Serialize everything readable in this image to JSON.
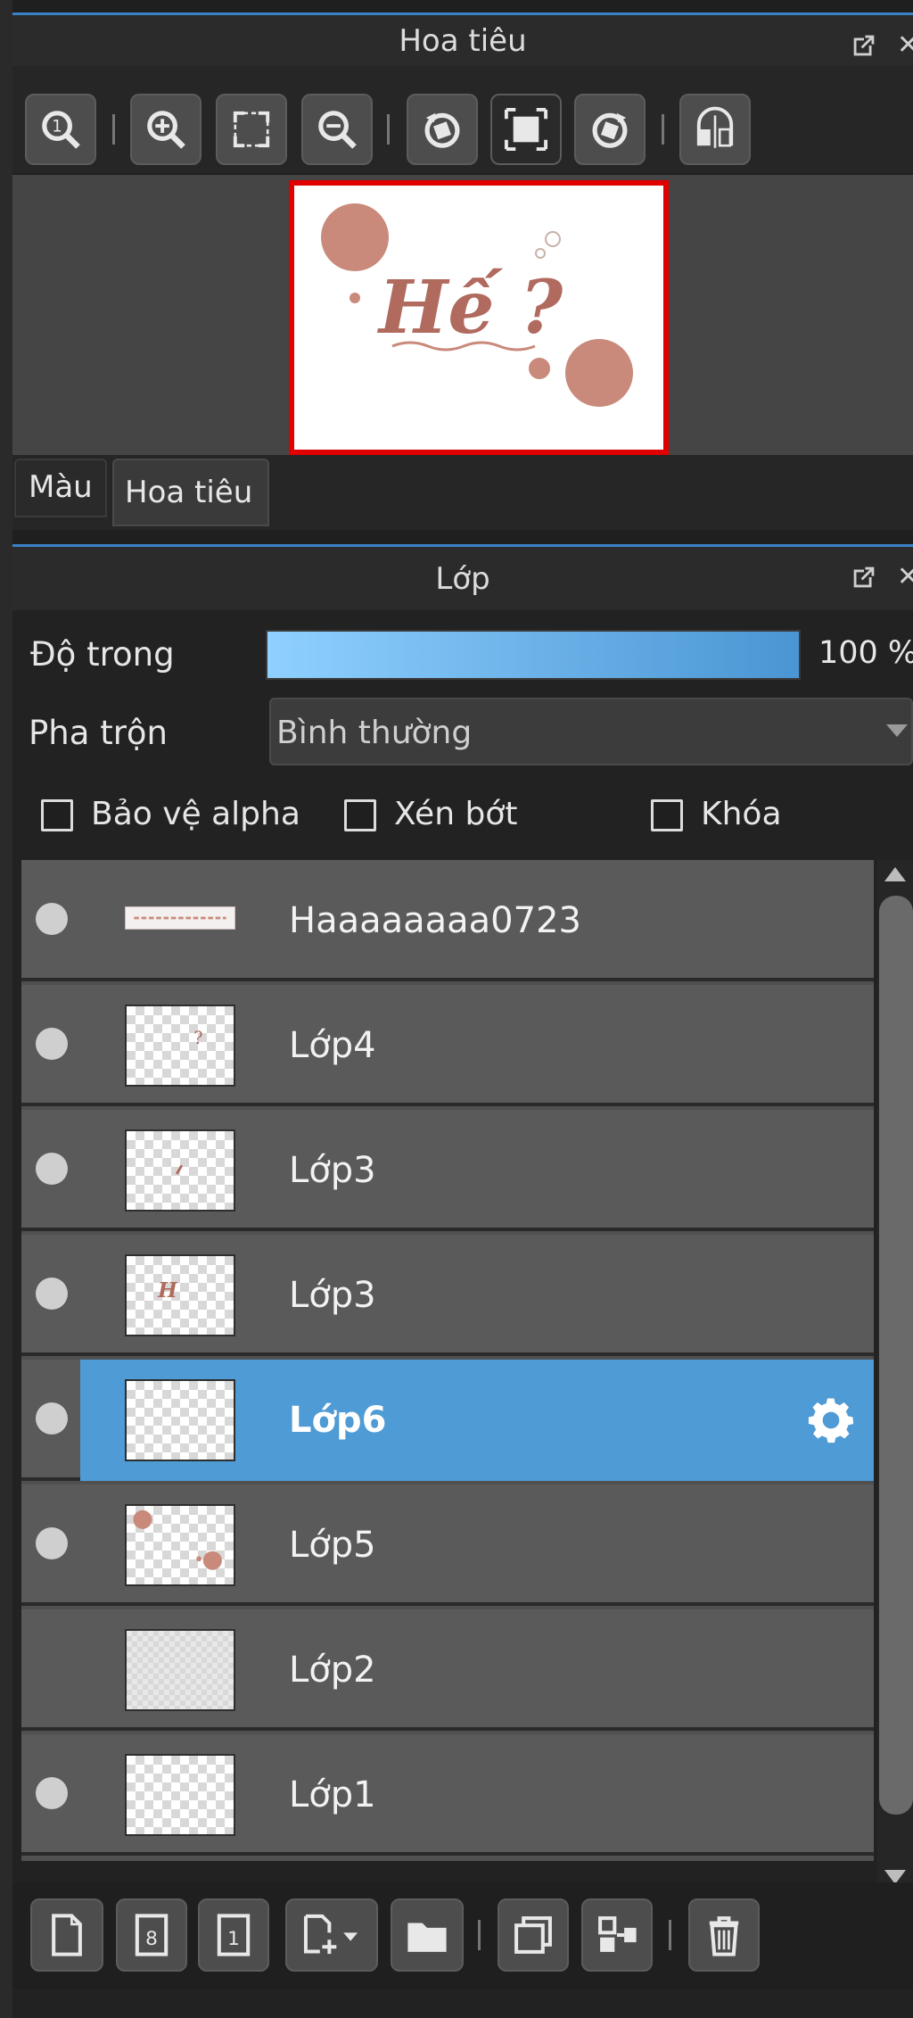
{
  "navigator": {
    "title": "Hoa tiêu",
    "tools": [
      {
        "name": "zoom-actual-icon"
      },
      {
        "name": "zoom-in-icon"
      },
      {
        "name": "fit-window-icon"
      },
      {
        "name": "zoom-out-icon"
      },
      {
        "name": "rotate-left-icon"
      },
      {
        "name": "fit-canvas-icon"
      },
      {
        "name": "rotate-right-icon"
      },
      {
        "name": "flip-horizontal-icon"
      }
    ],
    "preview": {
      "text": "Hế ?",
      "frame_color": "#e00000",
      "accent_color": "#c98a7c"
    },
    "tabs": [
      {
        "label": "Màu",
        "active": false
      },
      {
        "label": "Hoa tiêu",
        "active": true
      }
    ]
  },
  "layers_panel": {
    "title": "Lớp",
    "opacity": {
      "label": "Độ trong",
      "value_text": "100 %",
      "value": 1.0
    },
    "blend": {
      "label": "Pha trộn",
      "value": "Bình thường"
    },
    "checkboxes": [
      {
        "label": "Bảo vệ alpha",
        "checked": false
      },
      {
        "label": "Xén bớt",
        "checked": false
      },
      {
        "label": "Khóa",
        "checked": false
      }
    ],
    "layers": [
      {
        "name": "Haaaaaaaa0723",
        "visible": true,
        "selected": false
      },
      {
        "name": "Lớp4",
        "visible": true,
        "selected": false
      },
      {
        "name": "Lớp3",
        "visible": true,
        "selected": false
      },
      {
        "name": "Lớp3",
        "visible": true,
        "selected": false
      },
      {
        "name": "Lớp6",
        "visible": true,
        "selected": true
      },
      {
        "name": "Lớp5",
        "visible": true,
        "selected": false
      },
      {
        "name": "Lớp2",
        "visible": false,
        "selected": false
      },
      {
        "name": "Lớp1",
        "visible": true,
        "selected": false
      }
    ],
    "selected_color": "#4f9bd5",
    "bottom_tools": [
      {
        "name": "new-layer-icon"
      },
      {
        "name": "new-8bit-layer-icon"
      },
      {
        "name": "new-1bit-layer-icon"
      },
      {
        "name": "add-layer-menu-icon"
      },
      {
        "name": "folder-icon"
      },
      {
        "name": "duplicate-layer-icon"
      },
      {
        "name": "merge-down-icon"
      },
      {
        "name": "delete-layer-icon"
      }
    ]
  }
}
